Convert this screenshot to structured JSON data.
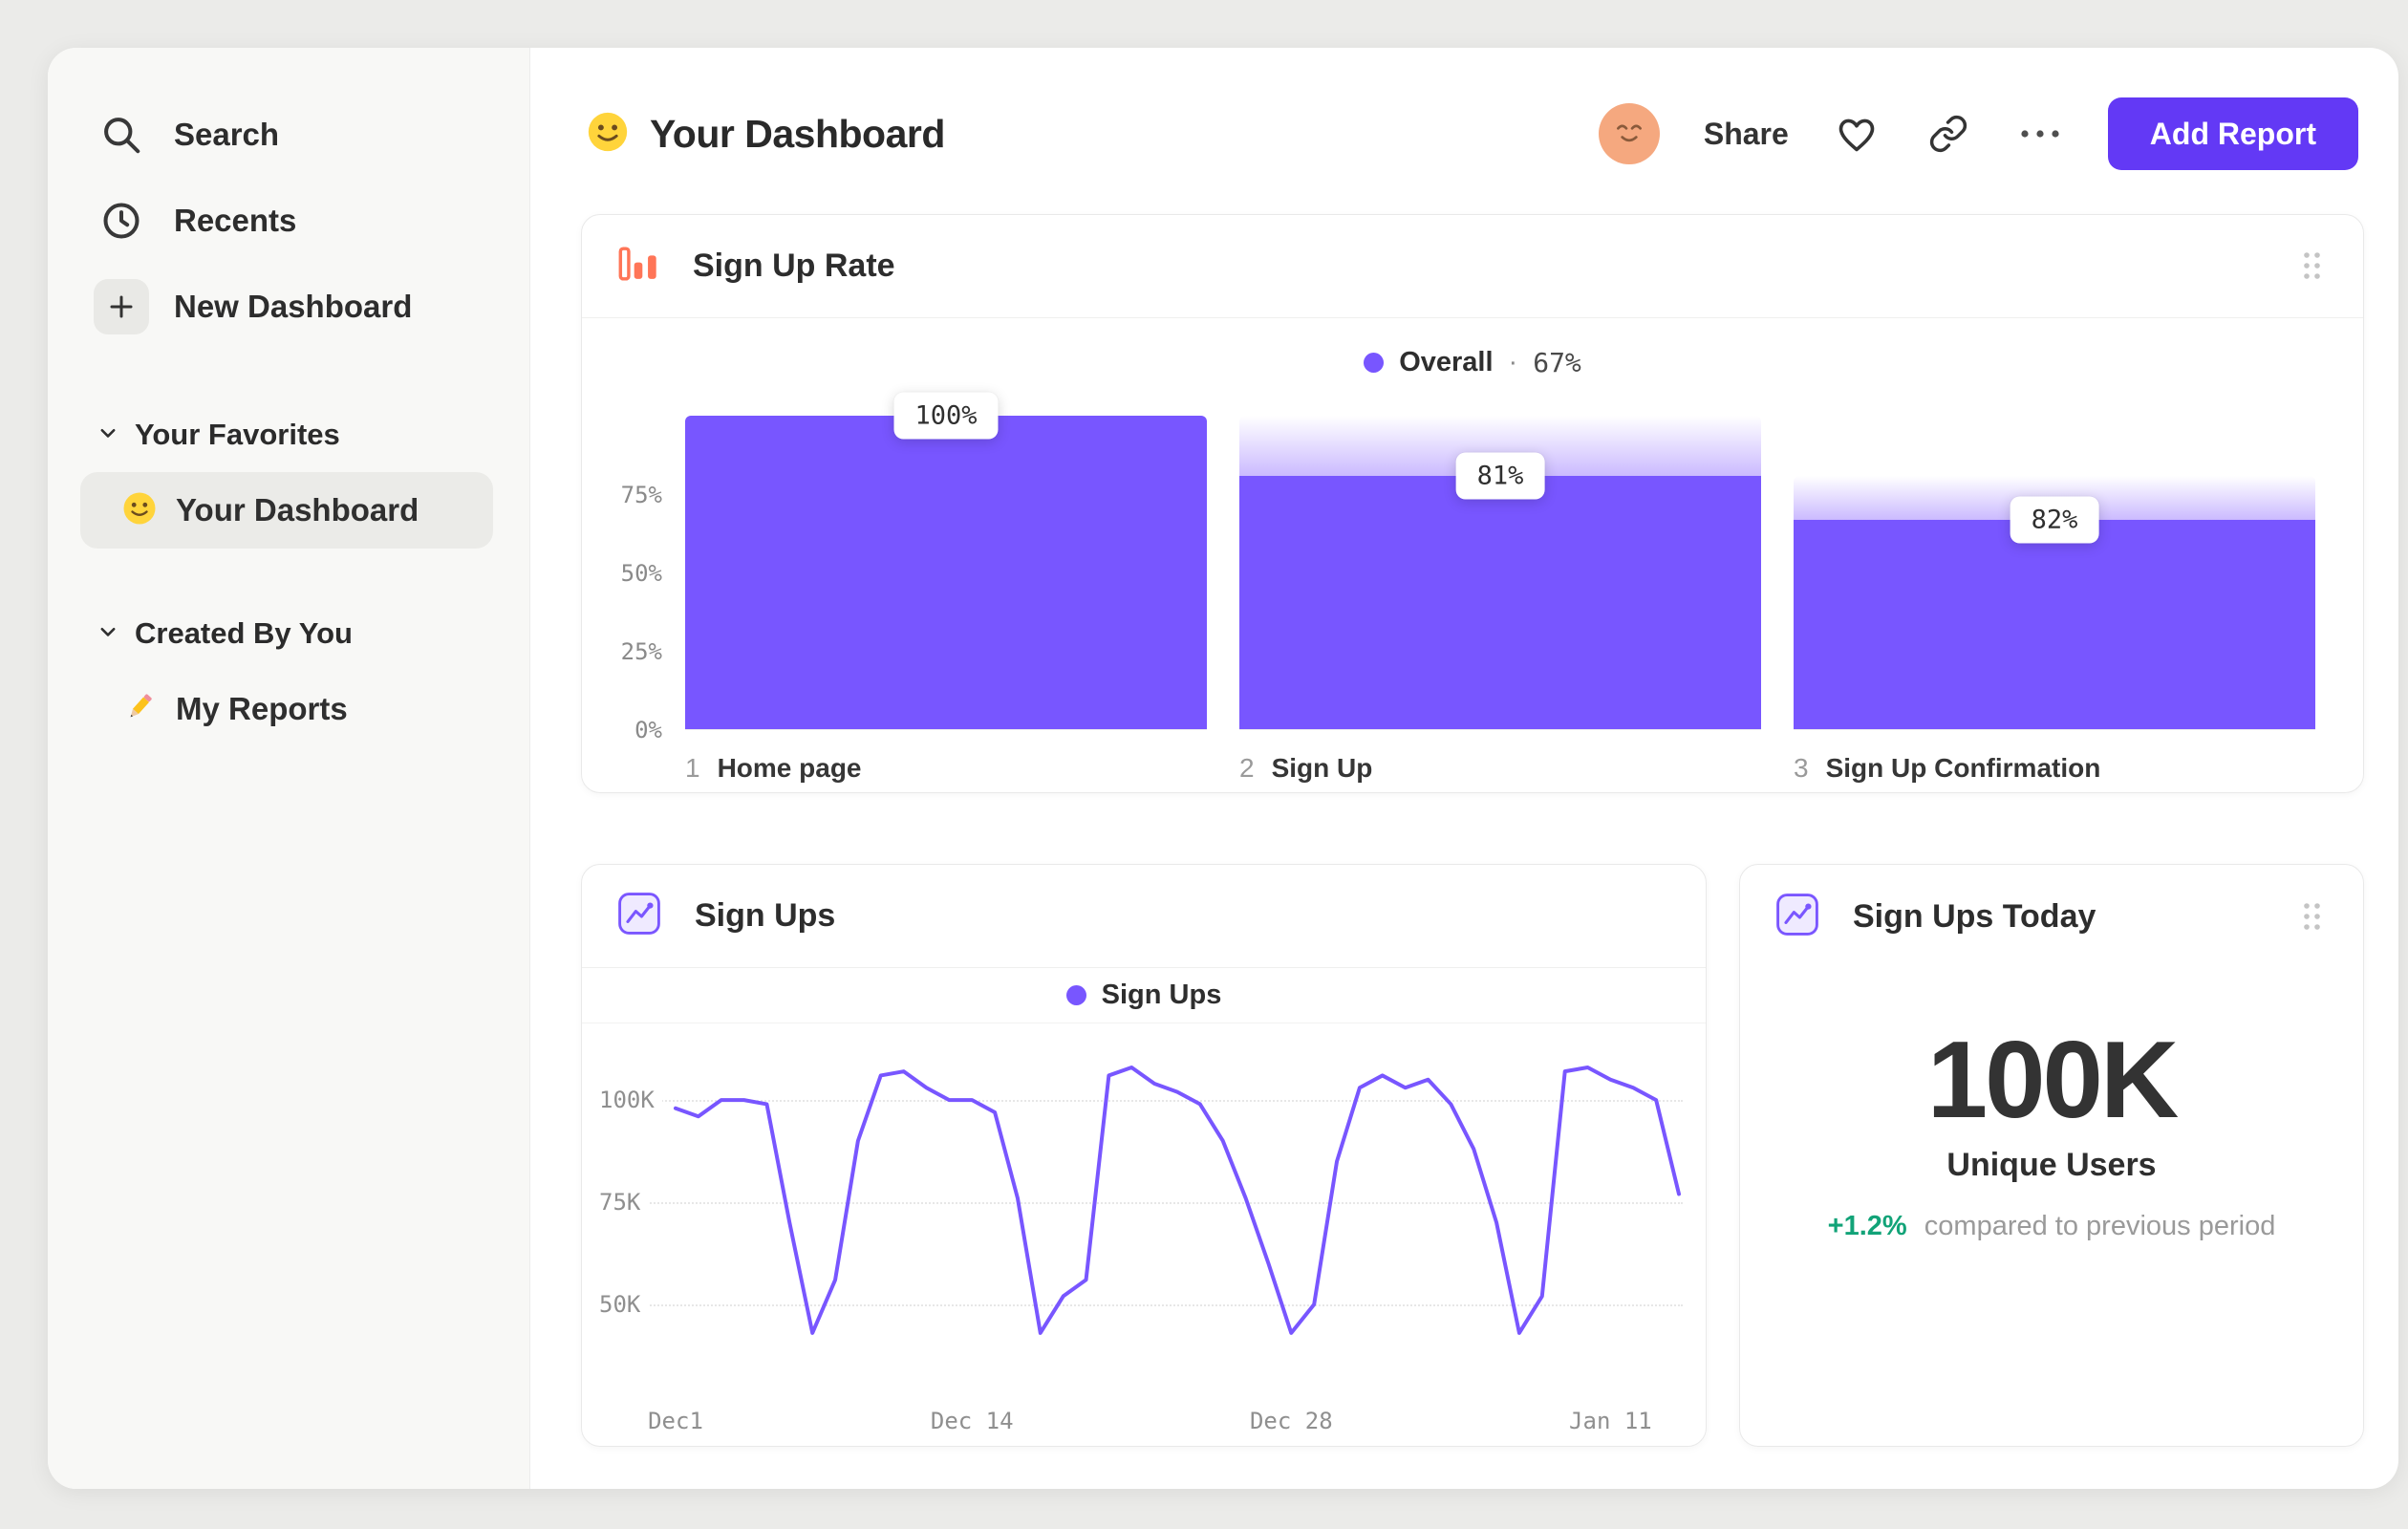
{
  "colors": {
    "purple": "#7856ff",
    "button_purple": "#6339f5",
    "orange": "#ff7557",
    "green": "#12a378",
    "sidebar_bg": "#f8f8f6",
    "page_bg": "#ebebe9",
    "border": "#ececec",
    "avatar_bg": "#f5a87f",
    "active_item_bg": "#ebebe8",
    "funnel_gradient_bottom": "#cbbaff"
  },
  "sidebar": {
    "items": [
      {
        "label": "Search",
        "icon": "search"
      },
      {
        "label": "Recents",
        "icon": "clock"
      },
      {
        "label": "New Dashboard",
        "icon": "plus"
      }
    ],
    "sections": [
      {
        "title": "Your Favorites",
        "items": [
          {
            "label": "Your Dashboard",
            "icon": "smiley-face",
            "active": true
          }
        ]
      },
      {
        "title": "Created By You",
        "items": [
          {
            "label": "My Reports",
            "icon": "pencil",
            "active": false
          }
        ]
      }
    ]
  },
  "header": {
    "title": "Your Dashboard",
    "title_icon": "smiley-face",
    "avatar_icon": "relieved-face",
    "share_label": "Share",
    "add_report_label": "Add Report"
  },
  "cards": {
    "funnel": {
      "title": "Sign Up Rate",
      "legend": {
        "name": "Overall",
        "separator": "·",
        "value": "67%"
      }
    },
    "line": {
      "title": "Sign Ups",
      "legend": {
        "name": "Sign Ups"
      }
    },
    "stat": {
      "title": "Sign Ups Today",
      "value": "100K",
      "label": "Unique Users",
      "delta": "+1.2%",
      "delta_note": "compared to previous period"
    }
  },
  "chart_data": [
    {
      "type": "bar",
      "subtype": "funnel",
      "title": "Sign Up Rate",
      "overall_conversion": "67%",
      "bar_color": "#7856ff",
      "steps": [
        {
          "index": "1",
          "label": "Home page",
          "value_display": "100%",
          "conversion_from_previous_pct": 100,
          "overall_pct": 100
        },
        {
          "index": "2",
          "label": "Sign Up",
          "value_display": "81%",
          "conversion_from_previous_pct": 81,
          "overall_pct": 81
        },
        {
          "index": "3",
          "label": "Sign Up Confirmation",
          "value_display": "82%",
          "conversion_from_previous_pct": 82,
          "overall_pct": 67
        }
      ],
      "y_ticks_pct": [
        0,
        25,
        50,
        75
      ],
      "ymax_pct": 105
    },
    {
      "type": "line",
      "title": "Sign Ups",
      "unit": "thousands",
      "series": [
        {
          "name": "Sign Ups",
          "color": "#7856ff",
          "values": [
            98,
            96,
            100,
            100,
            99,
            70,
            43,
            56,
            90,
            106,
            107,
            103,
            100,
            100,
            97,
            76,
            43,
            52,
            56,
            106,
            108,
            104,
            102,
            99,
            90,
            76,
            60,
            43,
            50,
            85,
            103,
            106,
            103,
            105,
            99,
            88,
            70,
            43,
            52,
            107,
            108,
            105,
            103,
            100,
            77
          ]
        }
      ],
      "x_ticks": [
        {
          "day": 0,
          "label": "Dec1"
        },
        {
          "day": 13,
          "label": "Dec 14"
        },
        {
          "day": 27,
          "label": "Dec 28"
        },
        {
          "day": 41,
          "label": "Jan 11"
        }
      ],
      "y_ticks": [
        {
          "value": 50,
          "label": "50K"
        },
        {
          "value": 75,
          "label": "75K"
        },
        {
          "value": 100,
          "label": "100K"
        }
      ],
      "y_range": [
        28,
        115
      ],
      "grid": "dotted-horizontal",
      "legend_position": "top-center"
    },
    {
      "type": "number",
      "title": "Sign Ups Today",
      "value": "100K",
      "label": "Unique Users",
      "change": "+1.2%",
      "change_note": "compared to previous period"
    }
  ]
}
